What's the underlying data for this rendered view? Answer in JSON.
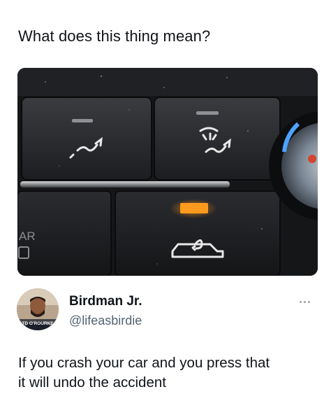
{
  "post": {
    "question": "What does this thing mean?",
    "photo_alt": "car dashboard recirculation button"
  },
  "reply": {
    "author_name": "Birdman Jr.",
    "author_handle": "@lifeasbirdie",
    "avatar_caption": "TD O'ROURKE",
    "text_line1": "If you crash your car and you press that",
    "text_line2": "it will undo the accident",
    "more_icon": "more-dots-icon"
  },
  "photo_labels": {
    "side_label": "AR"
  },
  "colors": {
    "text": "#0f1419",
    "secondary": "#536471",
    "indicator": "#ff9a1f"
  }
}
